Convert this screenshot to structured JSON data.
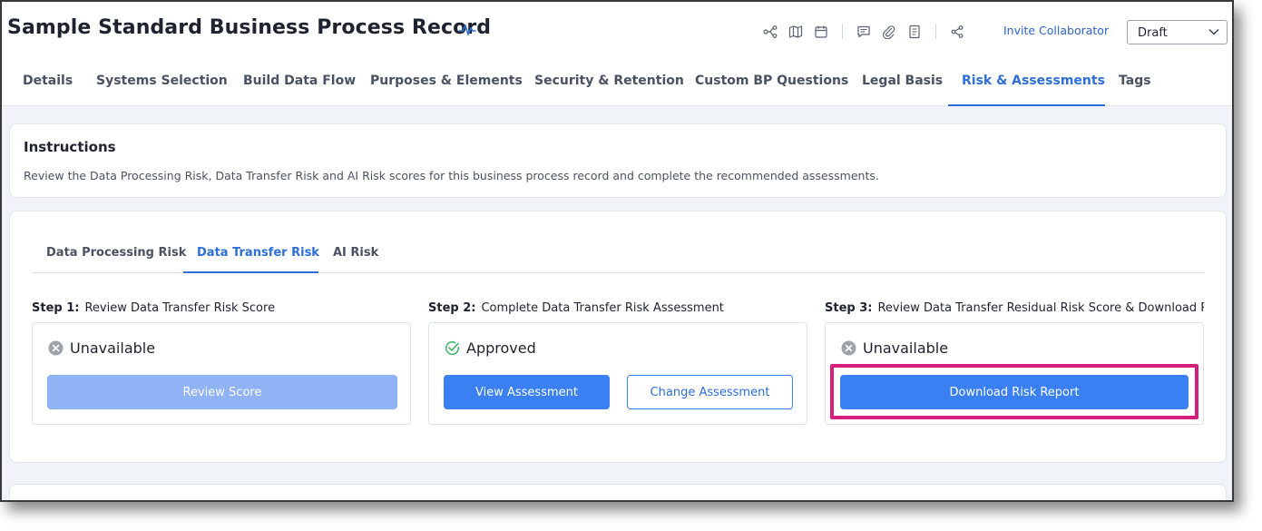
{
  "header": {
    "title": "Sample Standard Business Process Record",
    "invite_label": "Invite Collaborator",
    "status_value": "Draft"
  },
  "toolbar_icons": [
    "data-flow-icon",
    "map-icon",
    "calendar-icon",
    "comment-icon",
    "attachment-icon",
    "document-icon",
    "share-icon"
  ],
  "tabs": [
    {
      "label": "Details"
    },
    {
      "label": "Systems Selection"
    },
    {
      "label": "Build Data Flow"
    },
    {
      "label": "Purposes & Elements"
    },
    {
      "label": "Security & Retention"
    },
    {
      "label": "Custom BP Questions"
    },
    {
      "label": "Legal Basis"
    },
    {
      "label": "Risk & Assessments"
    },
    {
      "label": "Tags"
    }
  ],
  "active_tab": "Risk & Assessments",
  "instructions": {
    "title": "Instructions",
    "text": "Review the Data Processing Risk, Data Transfer Risk and AI Risk scores for this business process record and complete the recommended assessments."
  },
  "risk_tabs": [
    {
      "label": "Data Processing Risk"
    },
    {
      "label": "Data Transfer Risk"
    },
    {
      "label": "AI Risk"
    }
  ],
  "active_risk_tab": "Data Transfer Risk",
  "steps": [
    {
      "step": "Step 1:",
      "label": "Review Data Transfer Risk Score",
      "status": "Unavailable",
      "status_icon": "x-circle-icon",
      "buttons": [
        {
          "label": "Review Score",
          "style": "disabled"
        }
      ]
    },
    {
      "step": "Step 2:",
      "label": "Complete Data Transfer Risk Assessment",
      "status": "Approved",
      "status_icon": "check-circle-icon",
      "buttons": [
        {
          "label": "View Assessment",
          "style": "primary"
        },
        {
          "label": "Change Assessment",
          "style": "outline"
        }
      ]
    },
    {
      "step": "Step 3:",
      "label": "Review Data Transfer Residual Risk Score & Download Re...",
      "status": "Unavailable",
      "status_icon": "x-circle-icon",
      "buttons": [
        {
          "label": "Download Risk Report",
          "style": "primary"
        }
      ]
    }
  ],
  "colors": {
    "accent": "#2d6fd6",
    "primary_button": "#3a80f2",
    "disabled_button": "#8fb3f5",
    "highlight": "#d61f7c",
    "approved_green": "#3fb66b"
  }
}
